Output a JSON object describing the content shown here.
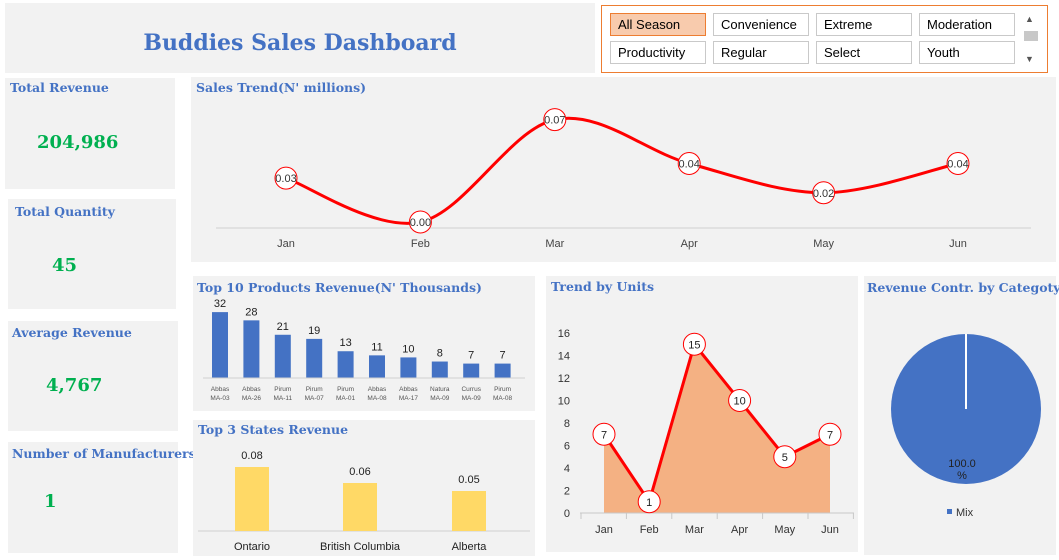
{
  "dashboard": {
    "title": "Buddies Sales Dashboard"
  },
  "slicer": {
    "items": [
      "All Season",
      "Convenience",
      "Extreme",
      "Moderation",
      "Productivity",
      "Regular",
      "Select",
      "Youth"
    ],
    "selected": "All Season",
    "scroll_up": "▲",
    "scroll_down": "▼"
  },
  "kpis": [
    {
      "label": "Total Revenue",
      "value": "204,986"
    },
    {
      "label": "Total Quantity",
      "value": "45"
    },
    {
      "label": "Average Revenue",
      "value": "4,767"
    },
    {
      "label": "Number of Manufacturers",
      "value": "1"
    }
  ],
  "colors": {
    "accent": "#4472c4",
    "kpi": "#00b050",
    "trend": "#ff0000",
    "bars": "#4472c4",
    "states": "#ffd966",
    "area": "#f4b183",
    "pie": "#4472c4",
    "panel": "#f2f2f2",
    "slicer_border": "#ed7d31"
  },
  "chart_data": [
    {
      "type": "line",
      "title": "Sales Trend(N' millions)",
      "categories": [
        "Jan",
        "Feb",
        "Mar",
        "Apr",
        "May",
        "Jun"
      ],
      "values": [
        0.03,
        0.0,
        0.07,
        0.04,
        0.02,
        0.04
      ],
      "ylim": [
        0,
        0.08
      ],
      "grid": false
    },
    {
      "type": "bar",
      "title": "Top 10 Products Revenue(N' Thousands)",
      "categories": [
        [
          "Abbas",
          "MA-03"
        ],
        [
          "Abbas",
          "MA-26"
        ],
        [
          "Pirum",
          "MA-11"
        ],
        [
          "Pirum",
          "MA-07"
        ],
        [
          "Pirum",
          "MA-01"
        ],
        [
          "Abbas",
          "MA-08"
        ],
        [
          "Abbas",
          "MA-17"
        ],
        [
          "Natura",
          "MA-09"
        ],
        [
          "Currus",
          "MA-09"
        ],
        [
          "Pirum",
          "MA-08"
        ]
      ],
      "values": [
        32,
        28,
        21,
        19,
        13,
        11,
        10,
        8,
        7,
        7
      ],
      "ylim": [
        0,
        34
      ]
    },
    {
      "type": "bar",
      "title": "Top 3 States Revenue",
      "categories": [
        "Ontario",
        "British Columbia",
        "Alberta"
      ],
      "values": [
        0.08,
        0.06,
        0.05
      ],
      "ylim": [
        0,
        0.1
      ]
    },
    {
      "type": "area",
      "title": "Trend by Units",
      "categories": [
        "Jan",
        "Feb",
        "Mar",
        "Apr",
        "May",
        "Jun"
      ],
      "values": [
        7,
        1,
        15,
        10,
        5,
        7
      ],
      "ylim": [
        0,
        16
      ],
      "yticks": [
        0,
        2,
        4,
        6,
        8,
        10,
        12,
        14,
        16
      ],
      "grid": false
    },
    {
      "type": "pie",
      "title": "Revenue Contr. by Categoty",
      "series": [
        {
          "name": "Mix",
          "values": [
            100.0
          ]
        }
      ],
      "slice_labels": [
        "100.0\n%"
      ],
      "legend": [
        "Mix"
      ],
      "legend_position": "bottom"
    }
  ]
}
